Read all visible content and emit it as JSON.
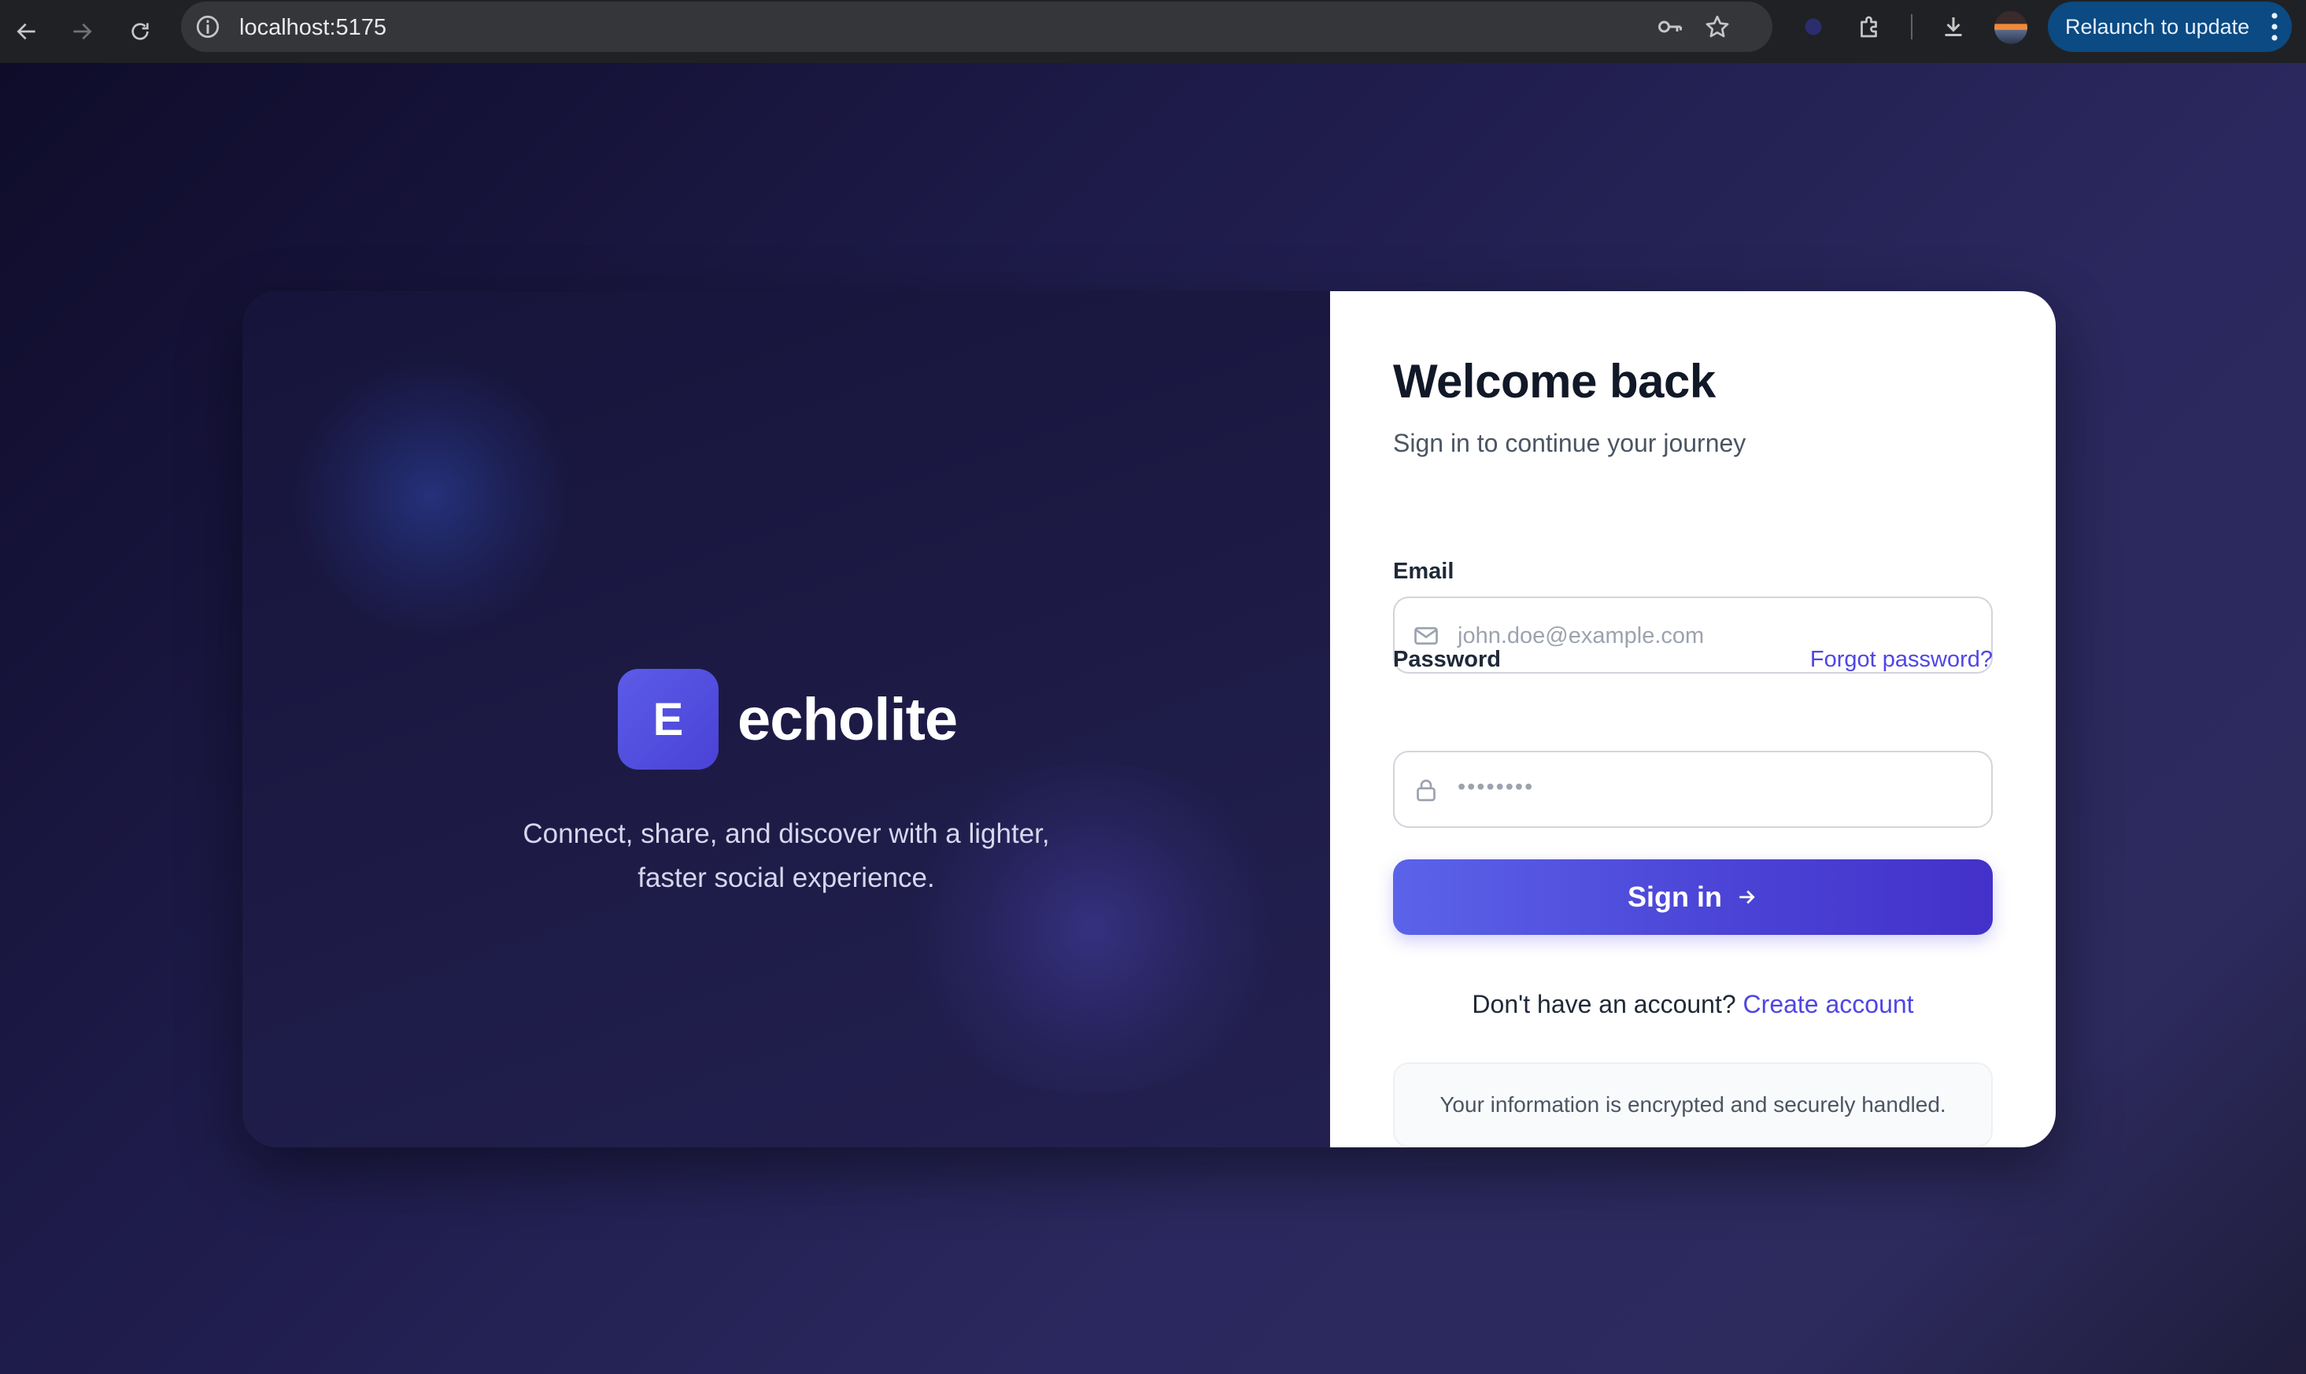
{
  "browser": {
    "url": "localhost:5175",
    "relaunch_label": "Relaunch to update"
  },
  "brand": {
    "logo_letter": "E",
    "name": "echolite",
    "tagline_line1": "Connect, share, and discover with a lighter,",
    "tagline_line2": "faster social experience."
  },
  "form": {
    "title": "Welcome back",
    "subtitle": "Sign in to continue your journey",
    "email_label": "Email",
    "email_placeholder": "john.doe@example.com",
    "password_label": "Password",
    "password_placeholder": "••••••••",
    "forgot_label": "Forgot password?",
    "submit_label": "Sign in",
    "signup_prompt": "Don't have an account?",
    "signup_link": "Create account",
    "security_note": "Your information is encrypted and securely handled."
  },
  "colors": {
    "accent": "#4f46e5",
    "logo_gradient_start": "#5b5ce8",
    "page_background": "#1e1b4a",
    "relaunch_button": "#0b4a82"
  },
  "icons": {
    "back": "arrow-left-icon",
    "forward": "arrow-right-icon",
    "reload": "reload-icon",
    "site_info": "info-icon",
    "password_manager": "key-icon",
    "bookmark": "star-icon",
    "extensions": "puzzle-icon",
    "downloads": "download-icon",
    "email_field": "mail-icon",
    "password_field": "lock-icon",
    "submit": "arrow-right-icon"
  }
}
